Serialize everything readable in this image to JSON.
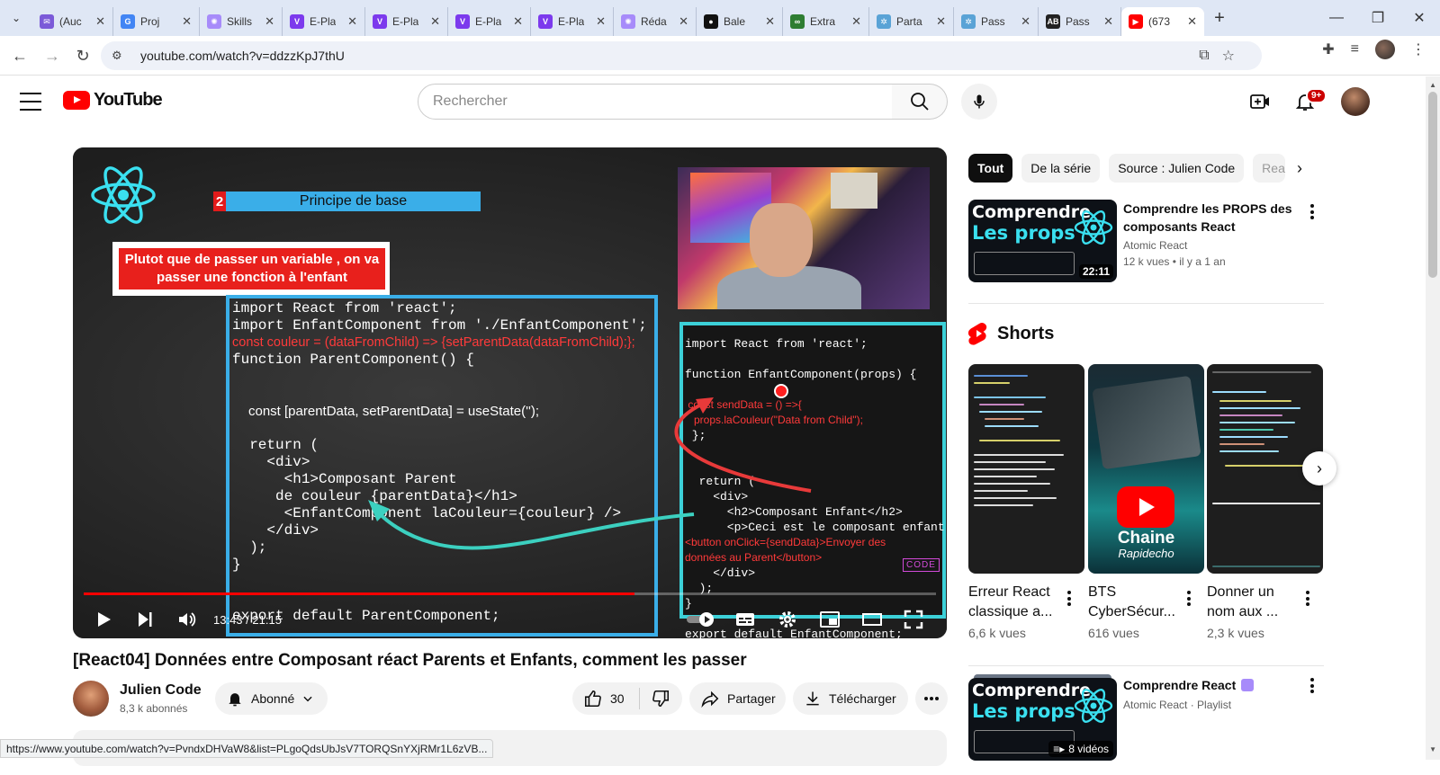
{
  "browser": {
    "tabs": [
      {
        "title": "(Auc",
        "icon": "mail-icon",
        "color": "#7b5ad8"
      },
      {
        "title": "Proj",
        "icon": "google-icon",
        "color": "#4285f4"
      },
      {
        "title": "Skills",
        "icon": "dots-icon",
        "color": "#a78bfa"
      },
      {
        "title": "E-Pla",
        "icon": "v-icon",
        "color": "#7c3aed"
      },
      {
        "title": "E-Pla",
        "icon": "v-icon",
        "color": "#7c3aed"
      },
      {
        "title": "E-Pla",
        "icon": "v-icon",
        "color": "#7c3aed"
      },
      {
        "title": "E-Pla",
        "icon": "v-icon",
        "color": "#7c3aed"
      },
      {
        "title": "Réda",
        "icon": "dots-icon",
        "color": "#a78bfa"
      },
      {
        "title": "Bale",
        "icon": "github-icon",
        "color": "#111111"
      },
      {
        "title": "Extra",
        "icon": "link-icon",
        "color": "#2e7d32"
      },
      {
        "title": "Parta",
        "icon": "gear-icon",
        "color": "#5aa3d6"
      },
      {
        "title": "Pass",
        "icon": "gear-icon",
        "color": "#5aa3d6"
      },
      {
        "title": "Pass",
        "icon": "ab-icon",
        "color": "#222222"
      },
      {
        "title": "(673",
        "icon": "youtube-icon",
        "color": "#ff0000"
      }
    ],
    "url": "youtube.com/watch?v=ddzzKpJ7thU",
    "status_url": "https://www.youtube.com/watch?v=PvndxDHVaW8&list=PLgoQdsUbJsV7TORQSnYXjRMr1L6zVB..."
  },
  "header": {
    "logo_text": "YouTube",
    "search_placeholder": "Rechercher",
    "notifications_badge": "9+"
  },
  "video": {
    "slide_number": "2",
    "slide_title": "Principe de base",
    "slide_note": "Plutot que de passer un variable , on va passer une fonction à l'enfant",
    "code_left": [
      "import React from 'react';",
      "import EnfantComponent from './EnfantComponent';",
      "const couleur = (dataFromChild) => {setParentData(dataFromChild);};",
      "function ParentComponent() {",
      "",
      "",
      "const [parentData, setParentData] = useState('');",
      "",
      "  return (",
      "    <div>",
      "      <h1>Composant Parent",
      "     de couleur {parentData}</h1>",
      "      <EnfantComponent laCouleur={couleur} />",
      "    </div>",
      "  );",
      "}",
      "",
      "",
      "export default ParentComponent;"
    ],
    "code_right": [
      "import React from 'react';",
      "",
      "function EnfantComponent(props) {",
      "",
      " const sendData = () =>{",
      "   props.laCouleur(\"Data from Child\");",
      " };",
      "",
      "",
      "  return (",
      "    <div>",
      "      <h2>Composant Enfant</h2>",
      "      <p>Ceci est le composant enfant",
      "<button onClick={sendData}>Envoyer des",
      "données au Parent</button>",
      "    </div>",
      "  );",
      "}",
      "",
      "export default EnfantComponent;"
    ],
    "brand_tag": "CODE",
    "time_current": "13:43",
    "time_total": "21:15",
    "progress": 0.646,
    "title": "[React04] Données entre Composant réact Parents et Enfants, comment les passer",
    "channel_name": "Julien Code",
    "subscribers": "8,3 k abonnés",
    "subscribe_label": "Abonné",
    "likes": "30",
    "share_label": "Partager",
    "download_label": "Télécharger"
  },
  "sidebar": {
    "chips": [
      "Tout",
      "De la série",
      "Source : Julien Code",
      "Rea"
    ],
    "reco1": {
      "thumb_line1": "Comprendre",
      "thumb_line2": "Les props",
      "duration": "22:11",
      "title": "Comprendre les PROPS des composants React",
      "channel": "Atomic React",
      "views": "12 k vues",
      "age": "il y a 1 an"
    },
    "shorts_title": "Shorts",
    "shorts": [
      {
        "title": "Erreur React classique a...",
        "views": "6,6 k vues"
      },
      {
        "title": "BTS CyberSécur...",
        "views": "616 vues",
        "overlay_title": "Chaine",
        "overlay_sub": "Rapidecho"
      },
      {
        "title": "Donner un nom aux ...",
        "views": "2,3 k vues"
      }
    ],
    "playlist": {
      "thumb_line1": "Comprendre",
      "thumb_line2": "Les props",
      "title": "Comprendre React",
      "meta": "Atomic React · Playlist",
      "count": "8 vidéos"
    }
  },
  "colors": {
    "youtube_red": "#ff0000",
    "react_cyan": "#3ae0f0",
    "slide_blue": "#3aaee8"
  }
}
